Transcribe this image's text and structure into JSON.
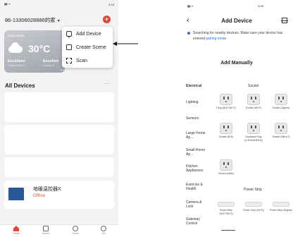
{
  "left": {
    "status_time": "5:18",
    "home_title": "86-13306028886的家",
    "weather": {
      "home_label": "Cozy Home",
      "temperature": "30°C",
      "quality_1": "Excellent",
      "quality_1_sub": "Outdoor PM2.5",
      "quality_2": "Excellen",
      "quality_2_sub": "Outdoor H"
    },
    "menu": [
      {
        "label": "Add Device",
        "icon": "add-device-icon"
      },
      {
        "label": "Create Scene",
        "icon": "create-scene-icon"
      },
      {
        "label": "Scan",
        "icon": "scan-icon"
      }
    ],
    "section_title": "All Devices",
    "device": {
      "name": "地暖温控器X",
      "status": "Offline"
    },
    "tabs": [
      {
        "label": "Home",
        "icon": "home-icon"
      },
      {
        "label": "Scene",
        "icon": "scene-icon"
      },
      {
        "label": "Smart",
        "icon": "smart-icon"
      },
      {
        "label": "Me",
        "icon": "me-icon"
      }
    ],
    "accent_color": "#e0463a"
  },
  "right": {
    "status_time": "3:08",
    "title": "Add Device",
    "searching_text": "Searching for nearby devices. Make sure your device has entered",
    "pairing_link": "pairing mode.",
    "add_manually": "Add Manually",
    "categories": [
      "Electrical",
      "Lighting",
      "Sensors",
      "Large Home Ap...",
      "Small Home Ap...",
      "Kitchen Appliances",
      "Exercise & Health",
      "Camera & Lock",
      "Gateway Control"
    ],
    "socket_header": "Socket",
    "power_strip_header": "Power Strip",
    "sockets": [
      {
        "label": "Plug (BLE+Wi-Fi)"
      },
      {
        "label": "Socket (Wi-Fi)"
      },
      {
        "label": "Socket (Zigbee)"
      },
      {
        "label": "Socket (BLE)"
      },
      {
        "label": "Dualband Plug (2.4GHz&5GHz)"
      },
      {
        "label": "Socket (NB-IoT)"
      },
      {
        "label": "Socket (other)"
      }
    ],
    "strips": [
      {
        "label": "Power Strip (BLE+Wi-Fi)"
      },
      {
        "label": "Power Strip (Wi-Fi)"
      },
      {
        "label": "Power Strip (Zigbee)"
      }
    ],
    "link_color": "#2f6fd0"
  }
}
